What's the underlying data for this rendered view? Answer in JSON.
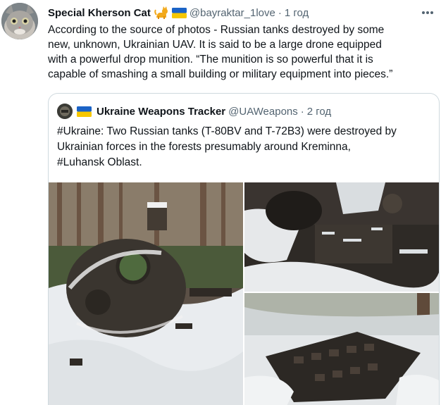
{
  "tweet": {
    "author_name": "Special Kherson Cat",
    "author_handle": "@bayraktar_1love",
    "separator": "·",
    "time": "1 год",
    "text": "According to the source of photos - Russian tanks destroyed by some\nnew, unknown, Ukrainian UAV. It is said to be a large drone equipped\nwith a powerful drop munition. “The munition is so powerful that it is\ncapable of smashing a small building or military equipment into pieces.”",
    "name_emojis": [
      "cat-emoji",
      "ukraine-flag-emoji"
    ]
  },
  "quoted": {
    "author_name": "Ukraine Weapons Tracker",
    "author_handle": "@UAWeapons",
    "separator": "·",
    "time": "2 год",
    "text": "#Ukraine: Two Russian tanks (T-80BV and T-72B3) were destroyed by\nUkrainian forces in the forests presumably around Kreminna,\n#Luhansk Oblast.",
    "name_emojis": [
      "ukraine-flag-emoji"
    ]
  },
  "photos": [
    {
      "name": "photo-destroyed-tank-turret"
    },
    {
      "name": "photo-tank-wreckage-snow"
    },
    {
      "name": "photo-tank-tracks-snow"
    }
  ],
  "colors": {
    "text": "#0f1419",
    "secondary": "#536471",
    "border": "#cfd9de",
    "flag_blue": "#1b63c6",
    "flag_yellow": "#f6c700"
  }
}
